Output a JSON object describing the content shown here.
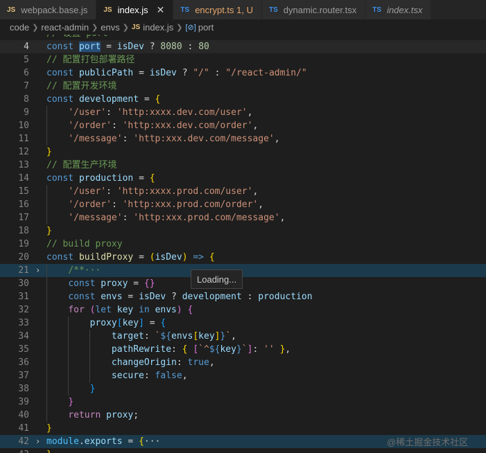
{
  "tabs": [
    {
      "icon": "JS",
      "label": "webpack.base.js"
    },
    {
      "icon": "JS",
      "label": "index.js",
      "close": "✕"
    },
    {
      "icon": "TS",
      "label": "encrypt.ts 1, U"
    },
    {
      "icon": "TS",
      "label": "dynamic.router.tsx"
    },
    {
      "icon": "TS",
      "label": "index.tsx"
    }
  ],
  "breadcrumb": {
    "parts": [
      "code",
      "react-admin",
      "envs"
    ],
    "file_icon": "JS",
    "file": "index.js",
    "symbol_icon": "[⊘]",
    "symbol": "port"
  },
  "editor": {
    "line_numbers": [
      "",
      "4",
      "5",
      "6",
      "7",
      "8",
      "9",
      "10",
      "11",
      "12",
      "13",
      "14",
      "15",
      "16",
      "17",
      "18",
      "19",
      "20",
      "21",
      "30",
      "31",
      "32",
      "33",
      "34",
      "35",
      "36",
      "37",
      "38",
      "39",
      "40",
      "41",
      "42",
      "43"
    ],
    "fold_marker": "›",
    "lines": [
      [
        [
          "c",
          "// 设置 port"
        ]
      ],
      [
        [
          "k",
          "const "
        ],
        [
          "v",
          "port"
        ],
        [
          "p",
          " = "
        ],
        [
          "v",
          "isDev"
        ],
        [
          "p",
          " ? "
        ],
        [
          "n",
          "8080"
        ],
        [
          "p",
          " : "
        ],
        [
          "n",
          "80"
        ]
      ],
      [
        [
          "c",
          "// 配置打包部署路径"
        ]
      ],
      [
        [
          "k",
          "const "
        ],
        [
          "v",
          "publicPath"
        ],
        [
          "p",
          " = "
        ],
        [
          "v",
          "isDev"
        ],
        [
          "p",
          " ? "
        ],
        [
          "s",
          "\"/\""
        ],
        [
          "p",
          " : "
        ],
        [
          "s",
          "\"/react-admin/\""
        ]
      ],
      [
        [
          "c",
          "// 配置开发环境"
        ]
      ],
      [
        [
          "k",
          "const "
        ],
        [
          "v",
          "development"
        ],
        [
          "p",
          " = "
        ],
        [
          "b1",
          "{"
        ]
      ],
      [
        [
          "p",
          "    "
        ],
        [
          "s",
          "'/user'"
        ],
        [
          "p",
          ": "
        ],
        [
          "s",
          "'http:xxxx.dev.com/user'"
        ],
        [
          "p",
          ","
        ]
      ],
      [
        [
          "p",
          "    "
        ],
        [
          "s",
          "'/order'"
        ],
        [
          "p",
          ": "
        ],
        [
          "s",
          "'http:xxx.dev.com/order'"
        ],
        [
          "p",
          ","
        ]
      ],
      [
        [
          "p",
          "    "
        ],
        [
          "s",
          "'/message'"
        ],
        [
          "p",
          ": "
        ],
        [
          "s",
          "'http:xxx.dev.com/message'"
        ],
        [
          "p",
          ","
        ]
      ],
      [
        [
          "b1",
          "}"
        ]
      ],
      [
        [
          "c",
          "// 配置生产环境"
        ]
      ],
      [
        [
          "k",
          "const "
        ],
        [
          "v",
          "production"
        ],
        [
          "p",
          " = "
        ],
        [
          "b1",
          "{"
        ]
      ],
      [
        [
          "p",
          "    "
        ],
        [
          "s",
          "'/user'"
        ],
        [
          "p",
          ": "
        ],
        [
          "s",
          "'http:xxxx.prod.com/user'"
        ],
        [
          "p",
          ","
        ]
      ],
      [
        [
          "p",
          "    "
        ],
        [
          "s",
          "'/order'"
        ],
        [
          "p",
          ": "
        ],
        [
          "s",
          "'http:xxx.prod.com/order'"
        ],
        [
          "p",
          ","
        ]
      ],
      [
        [
          "p",
          "    "
        ],
        [
          "s",
          "'/message'"
        ],
        [
          "p",
          ": "
        ],
        [
          "s",
          "'http:xxx.prod.com/message'"
        ],
        [
          "p",
          ","
        ]
      ],
      [
        [
          "b1",
          "}"
        ]
      ],
      [
        [
          "c",
          "// build proxy"
        ]
      ],
      [
        [
          "k",
          "const "
        ],
        [
          "f",
          "buildProxy"
        ],
        [
          "p",
          " = "
        ],
        [
          "b1",
          "("
        ],
        [
          "v",
          "isDev"
        ],
        [
          "b1",
          ")"
        ],
        [
          "p",
          " "
        ],
        [
          "k",
          "=>"
        ],
        [
          "p",
          " "
        ],
        [
          "b1",
          "{"
        ]
      ],
      [
        [
          "p",
          "    "
        ],
        [
          "c",
          "/**···"
        ]
      ],
      [
        [
          "p",
          "    "
        ],
        [
          "k",
          "const "
        ],
        [
          "v",
          "proxy"
        ],
        [
          "p",
          " = "
        ],
        [
          "b2",
          "{}"
        ]
      ],
      [
        [
          "p",
          "    "
        ],
        [
          "k",
          "const "
        ],
        [
          "v",
          "envs"
        ],
        [
          "p",
          " = "
        ],
        [
          "v",
          "isDev"
        ],
        [
          "p",
          " ? "
        ],
        [
          "v",
          "development"
        ],
        [
          "p",
          " : "
        ],
        [
          "v",
          "production"
        ]
      ],
      [
        [
          "p",
          "    "
        ],
        [
          "ctl",
          "for"
        ],
        [
          "p",
          " "
        ],
        [
          "b2",
          "("
        ],
        [
          "k",
          "let "
        ],
        [
          "v",
          "key"
        ],
        [
          "p",
          " "
        ],
        [
          "k",
          "in"
        ],
        [
          "p",
          " "
        ],
        [
          "v",
          "envs"
        ],
        [
          "b2",
          ")"
        ],
        [
          "p",
          " "
        ],
        [
          "b2",
          "{"
        ]
      ],
      [
        [
          "p",
          "        "
        ],
        [
          "v",
          "proxy"
        ],
        [
          "b3",
          "["
        ],
        [
          "v",
          "key"
        ],
        [
          "b3",
          "]"
        ],
        [
          "p",
          " = "
        ],
        [
          "b3",
          "{"
        ]
      ],
      [
        [
          "p",
          "            "
        ],
        [
          "v",
          "target"
        ],
        [
          "p",
          ": "
        ],
        [
          "s",
          "`"
        ],
        [
          "k",
          "${"
        ],
        [
          "v",
          "envs"
        ],
        [
          "b1",
          "["
        ],
        [
          "v",
          "key"
        ],
        [
          "b1",
          "]"
        ],
        [
          "k",
          "}"
        ],
        [
          "s",
          "`"
        ],
        [
          "p",
          ","
        ]
      ],
      [
        [
          "p",
          "            "
        ],
        [
          "v",
          "pathRewrite"
        ],
        [
          "p",
          ": "
        ],
        [
          "b1",
          "{"
        ],
        [
          "p",
          " "
        ],
        [
          "b2",
          "["
        ],
        [
          "s",
          "`^"
        ],
        [
          "k",
          "${"
        ],
        [
          "v",
          "key"
        ],
        [
          "k",
          "}"
        ],
        [
          "s",
          "`"
        ],
        [
          "b2",
          "]"
        ],
        [
          "p",
          ": "
        ],
        [
          "s",
          "''"
        ],
        [
          "p",
          " "
        ],
        [
          "b1",
          "}"
        ],
        [
          "p",
          ","
        ]
      ],
      [
        [
          "p",
          "            "
        ],
        [
          "v",
          "changeOrigin"
        ],
        [
          "p",
          ": "
        ],
        [
          "k",
          "true"
        ],
        [
          "p",
          ","
        ]
      ],
      [
        [
          "p",
          "            "
        ],
        [
          "v",
          "secure"
        ],
        [
          "p",
          ": "
        ],
        [
          "k",
          "false"
        ],
        [
          "p",
          ","
        ]
      ],
      [
        [
          "p",
          "        "
        ],
        [
          "b3",
          "}"
        ]
      ],
      [
        [
          "p",
          "    "
        ],
        [
          "b2",
          "}"
        ]
      ],
      [
        [
          "p",
          "    "
        ],
        [
          "ctl",
          "return"
        ],
        [
          "p",
          " "
        ],
        [
          "v",
          "proxy"
        ],
        [
          "p",
          ";"
        ]
      ],
      [
        [
          "b1",
          "}"
        ]
      ],
      [
        [
          "cst",
          "module"
        ],
        [
          "p",
          "."
        ],
        [
          "v",
          "exports"
        ],
        [
          "p",
          " = "
        ],
        [
          "b1",
          "{"
        ],
        [
          "p",
          "···"
        ]
      ],
      [
        [
          "b1",
          "}"
        ]
      ]
    ]
  },
  "tooltip": "Loading...",
  "watermark": "@稀土掘金技术社区"
}
